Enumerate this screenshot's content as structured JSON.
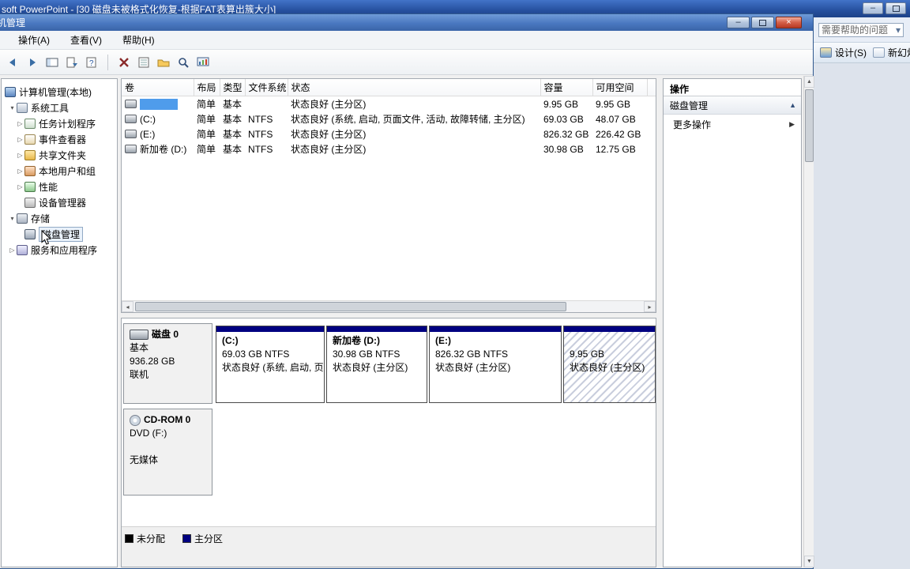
{
  "colors": {
    "primary_partition": "#000080",
    "unallocated": "#000000",
    "selection": "#4f9ceb"
  },
  "ppt": {
    "title": "soft PowerPoint - [30 磁盘未被格式化恢复-根据FAT表算出簇大小]",
    "help_placeholder": "需要帮助的问题",
    "design_label": "设计(S)",
    "new_slide_label": "新幻灯",
    "window_icons": [
      "minimize-icon",
      "maximize-icon"
    ]
  },
  "cm": {
    "title": "机管理",
    "menus": [
      {
        "label": "操作(A)"
      },
      {
        "label": "查看(V)"
      },
      {
        "label": "帮助(H)"
      }
    ],
    "window_icons": [
      "minimize-icon",
      "maximize-icon",
      "close-icon"
    ],
    "toolbar_icons": [
      "back-icon",
      "forward-icon",
      "show-console-tree-icon",
      "export-list-icon",
      "help-doc-icon",
      "delete-icon",
      "properties-icon",
      "open-folder-icon",
      "zoom-icon",
      "chart-icon"
    ]
  },
  "tree": {
    "items": [
      {
        "label": "计算机管理(本地)",
        "icon": "computer-icon"
      },
      {
        "label": "系统工具",
        "icon": "system-tools-icon",
        "state": "expanded"
      },
      {
        "label": "任务计划程序",
        "icon": "task-scheduler-icon",
        "state": "collapsed"
      },
      {
        "label": "事件查看器",
        "icon": "event-viewer-icon",
        "state": "collapsed"
      },
      {
        "label": "共享文件夹",
        "icon": "shared-folders-icon",
        "state": "collapsed"
      },
      {
        "label": "本地用户和组",
        "icon": "local-users-icon",
        "state": "collapsed"
      },
      {
        "label": "性能",
        "icon": "performance-icon",
        "state": "collapsed"
      },
      {
        "label": "设备管理器",
        "icon": "device-manager-icon"
      },
      {
        "label": "存储",
        "icon": "storage-icon",
        "state": "expanded"
      },
      {
        "label": "磁盘管理",
        "icon": "disk-management-icon",
        "selected": true
      },
      {
        "label": "服务和应用程序",
        "icon": "services-icon",
        "state": "collapsed"
      }
    ]
  },
  "volume_table": {
    "headers": [
      "卷",
      "布局",
      "类型",
      "文件系统",
      "状态",
      "容量",
      "可用空间"
    ],
    "rows": [
      {
        "volume": "",
        "layout": "简单",
        "type": "基本",
        "fs": "",
        "status": "状态良好 (主分区)",
        "capacity": "9.95 GB",
        "free": "9.95 GB",
        "selected": true
      },
      {
        "volume": "(C:)",
        "layout": "简单",
        "type": "基本",
        "fs": "NTFS",
        "status": "状态良好 (系统, 启动, 页面文件, 活动, 故障转储, 主分区)",
        "capacity": "69.03 GB",
        "free": "48.07 GB"
      },
      {
        "volume": "(E:)",
        "layout": "简单",
        "type": "基本",
        "fs": "NTFS",
        "status": "状态良好 (主分区)",
        "capacity": "826.32 GB",
        "free": "226.42 GB"
      },
      {
        "volume": "新加卷 (D:)",
        "layout": "简单",
        "type": "基本",
        "fs": "NTFS",
        "status": "状态良好 (主分区)",
        "capacity": "30.98 GB",
        "free": "12.75 GB"
      }
    ]
  },
  "graphics": {
    "disk0": {
      "name": "磁盘 0",
      "type": "基本",
      "size": "936.28 GB",
      "status": "联机",
      "partitions": [
        {
          "name": "(C:)",
          "size": "69.03 GB NTFS",
          "status": "状态良好 (系统, 启动, 页"
        },
        {
          "name": "新加卷  (D:)",
          "size": "30.98 GB NTFS",
          "status": "状态良好 (主分区)"
        },
        {
          "name": "(E:)",
          "size": "826.32 GB NTFS",
          "status": "状态良好 (主分区)"
        },
        {
          "name": "",
          "size": "9.95 GB",
          "status": "状态良好 (主分区)",
          "hatched": true
        }
      ]
    },
    "cdrom": {
      "name": "CD-ROM 0",
      "drive": "DVD (F:)",
      "status": "无媒体"
    }
  },
  "legend": {
    "items": [
      {
        "label": "未分配",
        "color": "#000000"
      },
      {
        "label": "主分区",
        "color": "#000080"
      }
    ]
  },
  "actions": {
    "title": "操作",
    "section_label": "磁盘管理",
    "more_label": "更多操作"
  }
}
